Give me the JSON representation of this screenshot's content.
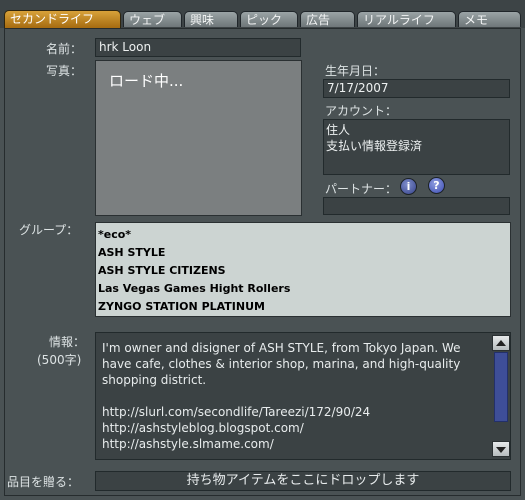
{
  "tabs": [
    {
      "label": "セカンドライフ",
      "active": true
    },
    {
      "label": "ウェブ",
      "active": false
    },
    {
      "label": "興味",
      "active": false
    },
    {
      "label": "ピック",
      "active": false
    },
    {
      "label": "広告",
      "active": false
    },
    {
      "label": "リアルライフ",
      "active": false
    },
    {
      "label": "メモ",
      "active": false
    }
  ],
  "profile": {
    "name_label": "名前：",
    "name_value": "hrk Loon",
    "photo_label": "写真：",
    "photo_loading": "ロード中...",
    "born_label": "生年月日：",
    "born_value": "7/17/2007",
    "account_label": "アカウント：",
    "account_lines": [
      "住人",
      "支払い情報登録済"
    ],
    "partner_label": "パートナー：",
    "partner_value": "",
    "groups_label": "グループ：",
    "groups": [
      "*eco*",
      "ASH STYLE",
      "ASH STYLE CITIZENS",
      "Las Vegas Games Hight Rollers",
      "ZYNGO STATION PLATINUM"
    ],
    "about_label": "情報：",
    "about_limit": "(500字)",
    "about_text": "I'm owner and disigner of ASH STYLE, from Tokyo Japan. We have cafe, clothes & interior shop, marina, and high-quality shopping district.\n\nhttp://slurl.com/secondlife/Tareezi/172/90/24\nhttp://ashstyleblog.blogspot.com/\nhttp://ashstyle.slmame.com/",
    "give_label": "品目を贈る：",
    "give_dropzone": "持ち物アイテムをここにドロップします"
  },
  "icons": {
    "info": "i",
    "help": "?"
  },
  "colors": {
    "active_tab": "#c8891f",
    "thumb": "#3e4e98",
    "groups_bg": "#ccd4d2"
  }
}
